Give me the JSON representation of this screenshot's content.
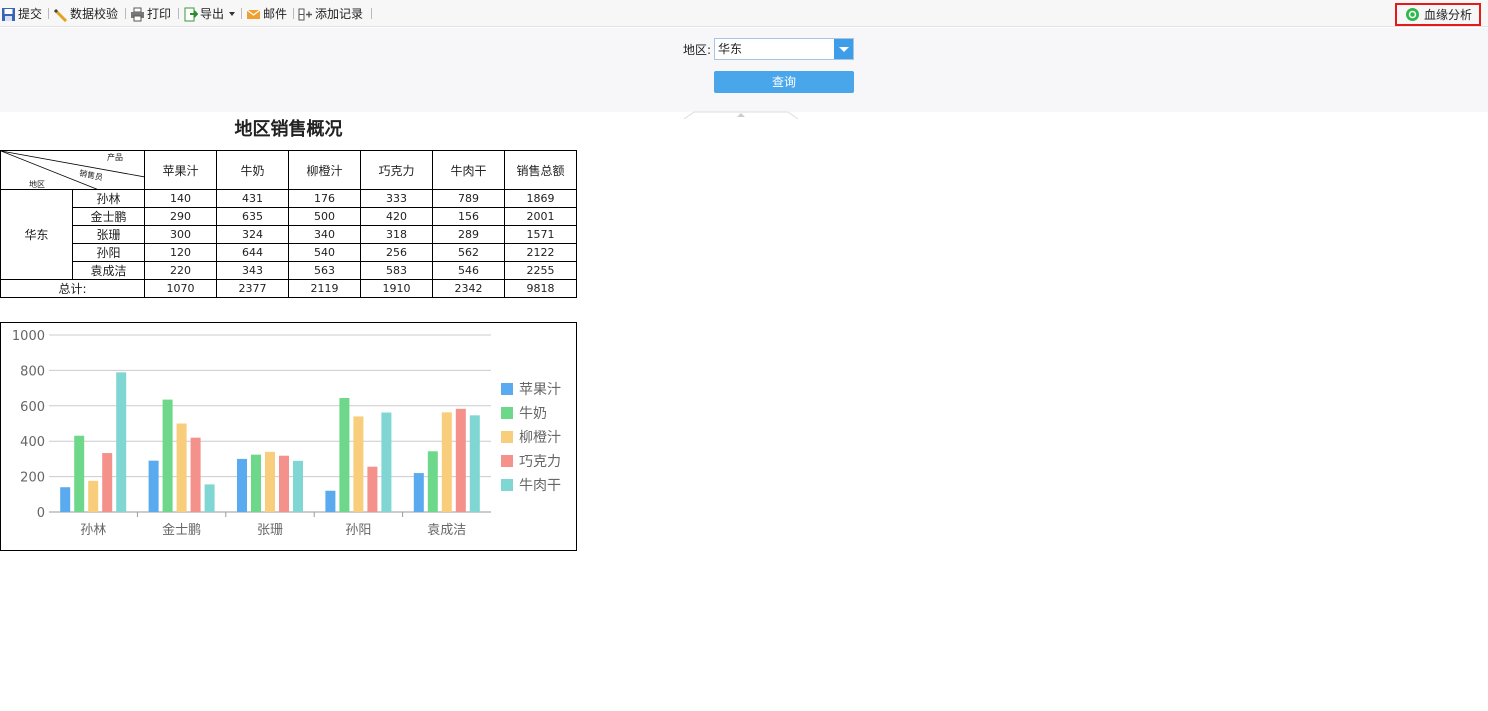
{
  "toolbar": {
    "submit_label": "提交",
    "validate_label": "数据校验",
    "print_label": "打印",
    "export_label": "导出",
    "email_label": "邮件",
    "add_record_label": "添加记录",
    "lineage_label": "血缘分析"
  },
  "params": {
    "region_label": "地区:",
    "region_value": "华东",
    "query_label": "查询"
  },
  "report": {
    "title": "地区销售概况",
    "corner": {
      "product": "产品",
      "salesperson": "销售员",
      "region": "地区"
    },
    "columns": [
      "苹果汁",
      "牛奶",
      "柳橙汁",
      "巧克力",
      "牛肉干",
      "销售总额"
    ],
    "region": "华东",
    "rows": [
      {
        "name": "孙林",
        "values": [
          "140",
          "431",
          "176",
          "333",
          "789",
          "1869"
        ]
      },
      {
        "name": "金士鹏",
        "values": [
          "290",
          "635",
          "500",
          "420",
          "156",
          "2001"
        ]
      },
      {
        "name": "张珊",
        "values": [
          "300",
          "324",
          "340",
          "318",
          "289",
          "1571"
        ]
      },
      {
        "name": "孙阳",
        "values": [
          "120",
          "644",
          "540",
          "256",
          "562",
          "2122"
        ]
      },
      {
        "name": "袁成洁",
        "values": [
          "220",
          "343",
          "563",
          "583",
          "546",
          "2255"
        ]
      }
    ],
    "total_label": "总计:",
    "totals": [
      "1070",
      "2377",
      "2119",
      "1910",
      "2342",
      "9818"
    ]
  },
  "chart_data": {
    "type": "bar",
    "categories": [
      "孙林",
      "金士鹏",
      "张珊",
      "孙阳",
      "袁成洁"
    ],
    "series": [
      {
        "name": "苹果汁",
        "color": "#5aaaf0",
        "values": [
          140,
          290,
          300,
          120,
          220
        ]
      },
      {
        "name": "牛奶",
        "color": "#6dd88a",
        "values": [
          431,
          635,
          324,
          644,
          343
        ]
      },
      {
        "name": "柳橙汁",
        "color": "#f8cd7b",
        "values": [
          176,
          500,
          340,
          540,
          563
        ]
      },
      {
        "name": "巧克力",
        "color": "#f4918a",
        "values": [
          333,
          420,
          318,
          256,
          583
        ]
      },
      {
        "name": "牛肉干",
        "color": "#7fd6d2",
        "values": [
          789,
          156,
          289,
          562,
          546
        ]
      }
    ],
    "yticks": [
      "0",
      "200",
      "400",
      "600",
      "800",
      "1000"
    ],
    "ylim": [
      0,
      1000
    ],
    "legend": "right",
    "grid": true
  }
}
